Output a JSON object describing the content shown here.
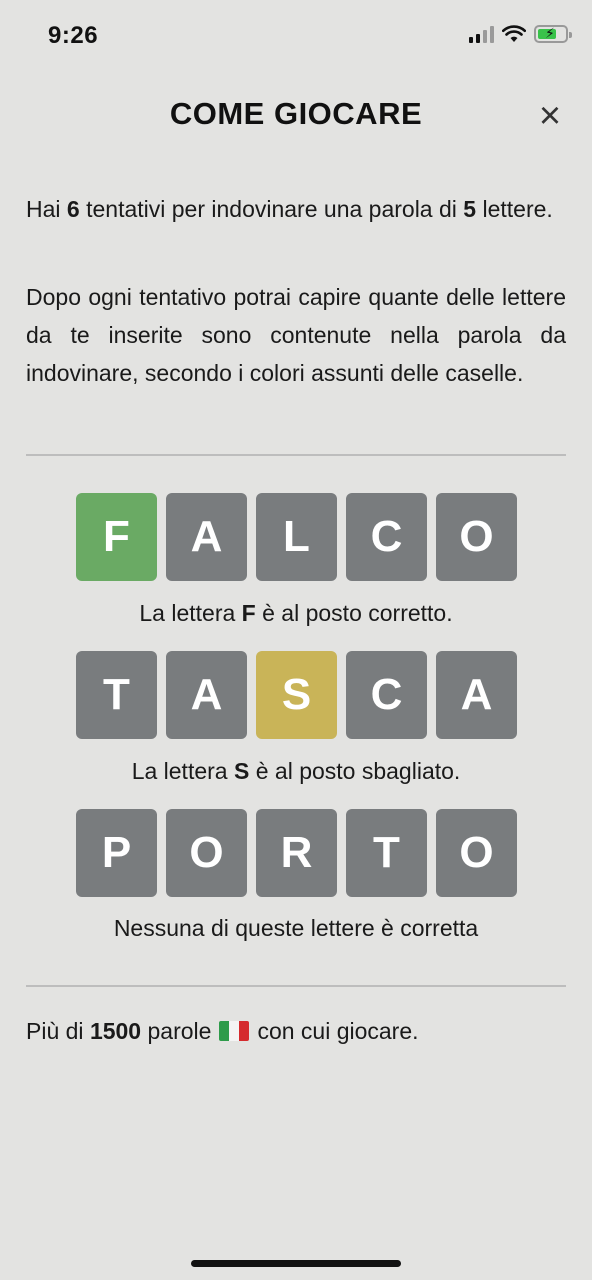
{
  "status": {
    "time": "9:26"
  },
  "header": {
    "title": "COME GIOCARE",
    "close_icon": "×"
  },
  "intro": {
    "p1_a": "Hai ",
    "p1_b": "6",
    "p1_c": " tentativi per indovinare una parola di ",
    "p1_d": "5",
    "p1_e": " lettere.",
    "p2": "Dopo ogni tentativo potrai capire quante delle lettere da te inserite sono contenute nella parola da indovinare, secondo i colori assunti delle caselle."
  },
  "examples": [
    {
      "letters": [
        "F",
        "A",
        "L",
        "C",
        "O"
      ],
      "states": [
        "correct",
        "absent",
        "absent",
        "absent",
        "absent"
      ],
      "caption_a": "La lettera ",
      "caption_b": "F",
      "caption_c": " è al posto corretto."
    },
    {
      "letters": [
        "T",
        "A",
        "S",
        "C",
        "A"
      ],
      "states": [
        "absent",
        "absent",
        "present",
        "absent",
        "absent"
      ],
      "caption_a": "La lettera ",
      "caption_b": "S",
      "caption_c": " è al posto sbagliato."
    },
    {
      "letters": [
        "P",
        "O",
        "R",
        "T",
        "O"
      ],
      "states": [
        "absent",
        "absent",
        "absent",
        "absent",
        "absent"
      ],
      "caption": "Nessuna di queste lettere è corretta"
    }
  ],
  "footer": {
    "a": "Più di ",
    "b": "1500",
    "c": " parole",
    "flag_icon": "italy-flag-icon",
    "d": " con cui giocare."
  },
  "colors": {
    "correct": "#6aaa64",
    "present": "#c9b458",
    "absent": "#797c7e",
    "background": "#e3e3e1"
  }
}
